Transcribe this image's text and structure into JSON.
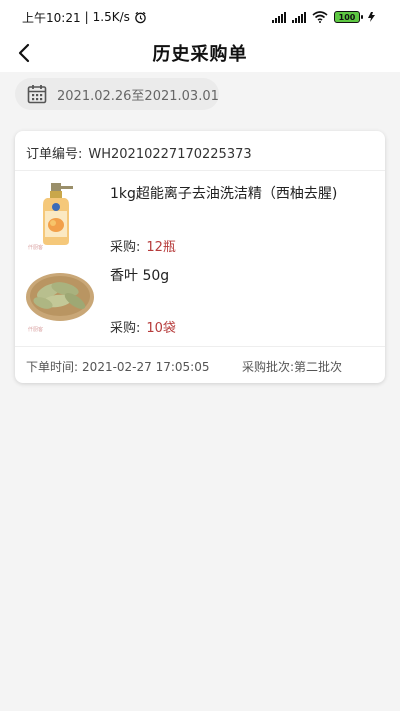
{
  "status_bar": {
    "time": "上午10:21",
    "speed": "1.5K/s",
    "battery": "100"
  },
  "nav": {
    "title": "历史采购单"
  },
  "date_range": "2021.02.26至2021.03.01",
  "order": {
    "label": "订单编号:",
    "number": "WH20210227170225373",
    "items": [
      {
        "name": "1kg超能离子去油洗洁精（西柚去腥)",
        "qty_label": "采购:",
        "qty_value": "12瓶",
        "image": "dish-soap-bottle"
      },
      {
        "name": "香叶 50g",
        "qty_label": "采购:",
        "qty_value": "10袋",
        "image": "bay-leaves"
      }
    ],
    "order_time_label": "下单时间:",
    "order_time": "2021-02-27 17:05:05",
    "batch_label": "采购批次:",
    "batch_value": "第二批次"
  },
  "colors": {
    "accent_qty": "#b63b3b",
    "background": "#f4f4f4"
  }
}
